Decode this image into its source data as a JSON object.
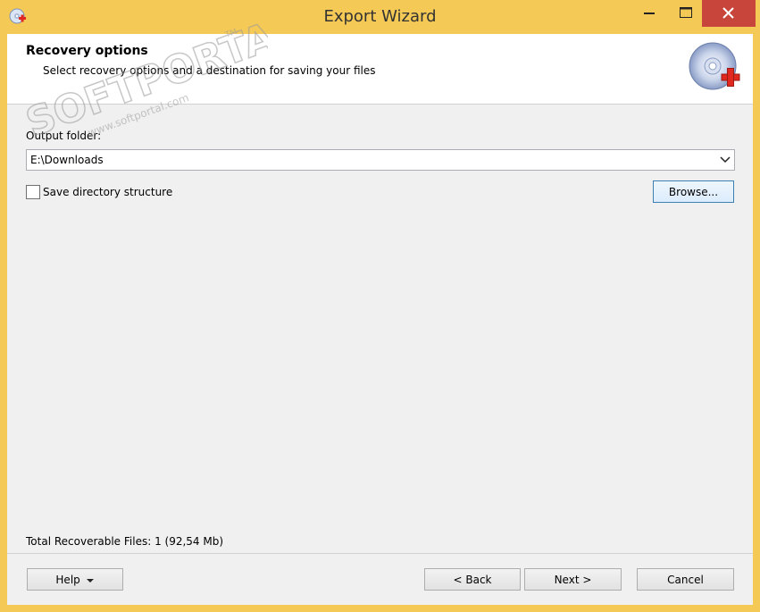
{
  "window": {
    "title": "Export Wizard"
  },
  "header": {
    "title": "Recovery options",
    "subtitle": "Select recovery options and a destination for saving your files"
  },
  "output": {
    "label": "Output folder:",
    "value": "E:\\Downloads"
  },
  "save_structure": {
    "label": "Save directory structure",
    "checked": false
  },
  "browse_label": "Browse...",
  "status": "Total Recoverable Files: 1 (92,54 Mb)",
  "buttons": {
    "help": "Help",
    "back": "< Back",
    "next": "Next >",
    "cancel": "Cancel"
  },
  "watermark": {
    "brand": "SOFTPORTAL",
    "url": "www.softportal.com",
    "tm": "TM"
  },
  "colors": {
    "titlebar": "#f4c955",
    "close": "#c7453a",
    "focus_border": "#3c7fb1"
  },
  "icons": {
    "app": "disk-recovery-icon",
    "header": "cd-plus-icon"
  }
}
